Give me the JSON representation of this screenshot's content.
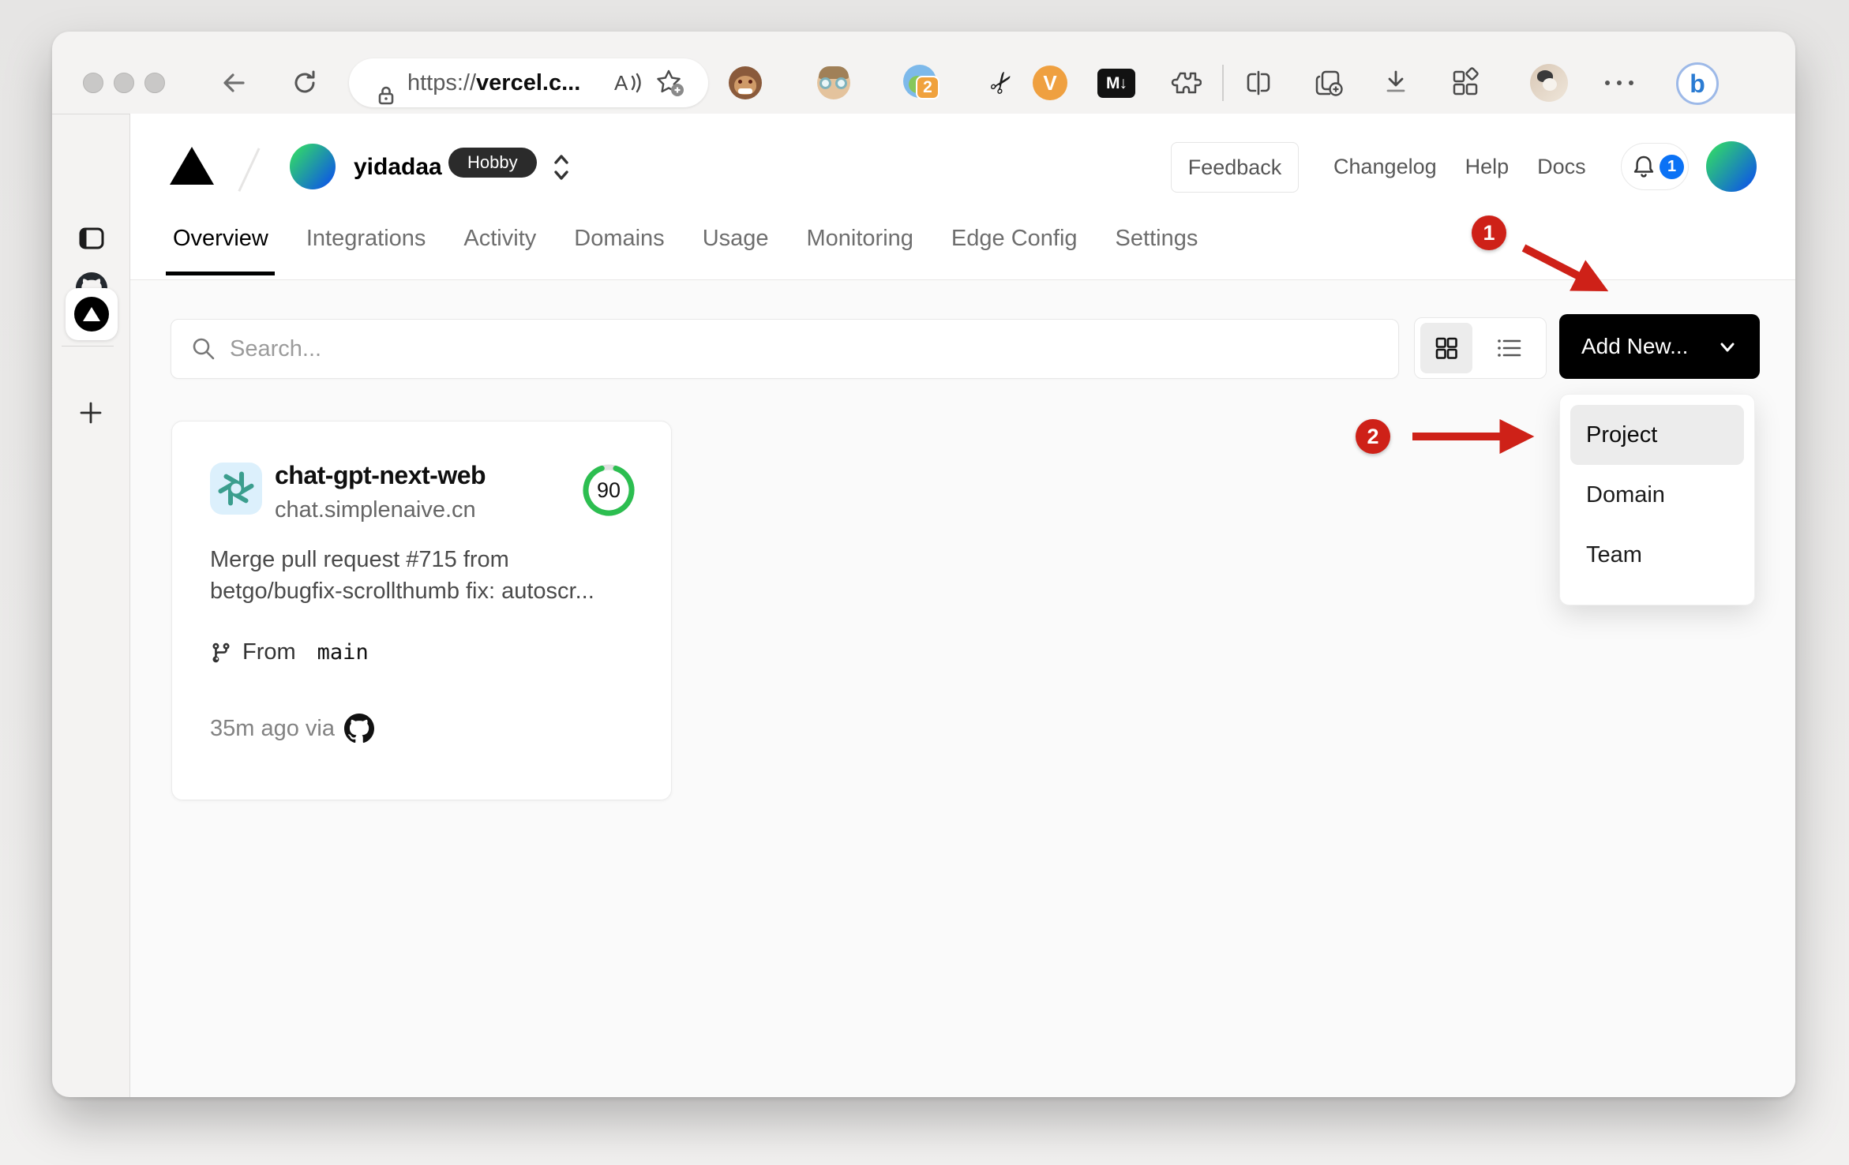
{
  "browser": {
    "url_scheme": "https://",
    "url_host": "vercel.c...",
    "extensions": {
      "translate_badge": "2",
      "markdown_label": "M↓",
      "v_label": "V",
      "bing_label": "b"
    }
  },
  "vercel": {
    "team_name": "yidadaa",
    "plan_badge": "Hobby",
    "header_links": {
      "feedback": "Feedback",
      "changelog": "Changelog",
      "help": "Help",
      "docs": "Docs"
    },
    "notification_count": "1",
    "tabs": [
      "Overview",
      "Integrations",
      "Activity",
      "Domains",
      "Usage",
      "Monitoring",
      "Edge Config",
      "Settings"
    ],
    "search_placeholder": "Search...",
    "add_new_label": "Add New...",
    "dropdown_items": [
      "Project",
      "Domain",
      "Team"
    ],
    "card": {
      "name": "chat-gpt-next-web",
      "domain": "chat.simplenaive.cn",
      "score": "90",
      "commit_line1": "Merge pull request #715 from",
      "commit_line2": "betgo/bugfix-scrollthumb fix: autoscr...",
      "from_label": "From",
      "branch": "main",
      "deployed": "35m ago via"
    }
  },
  "annotations": {
    "step1": "1",
    "step2": "2"
  },
  "colors": {
    "annotation_red": "#ce2118",
    "score_green": "#2cbe50",
    "notification_blue": "#0b72f5",
    "hobby_badge_bg": "#2b2b2b",
    "add_new_bg": "#000000"
  }
}
